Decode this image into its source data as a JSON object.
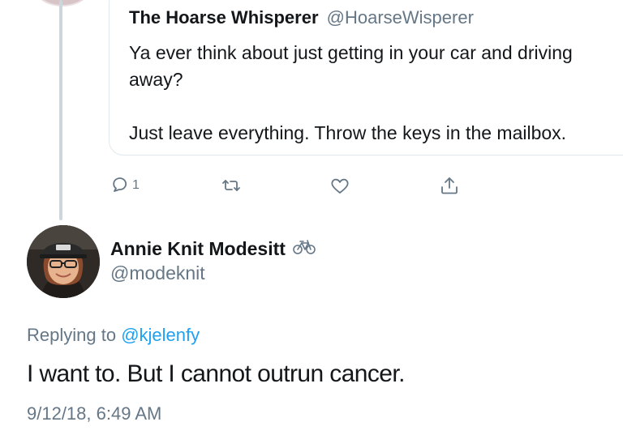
{
  "quoted_tweet": {
    "author_name": "The Hoarse Whisperer",
    "author_handle": "@HoarseWisperer",
    "text": "Ya ever think about just getting in your car and driving away?\n\nJust leave everything. Throw the keys in the mailbox.",
    "actions": {
      "reply_icon": "reply-icon",
      "reply_count": "1",
      "retweet_icon": "retweet-icon",
      "like_icon": "heart-icon",
      "share_icon": "share-icon"
    }
  },
  "tweet": {
    "author_name": "Annie Knit Modesitt",
    "author_emoji": "🚲",
    "author_handle": "@modeknit",
    "replying_prefix": "Replying to",
    "replying_mention": "@kjelenfy",
    "text": "I want to. But I cannot outrun cancer.",
    "timestamp": "9/12/18, 6:49 AM"
  },
  "colors": {
    "primary_text": "#14171a",
    "secondary_text": "#657786",
    "link": "#1da1f2",
    "border": "#e1e8ed",
    "thread_line": "#ccd6dd"
  }
}
